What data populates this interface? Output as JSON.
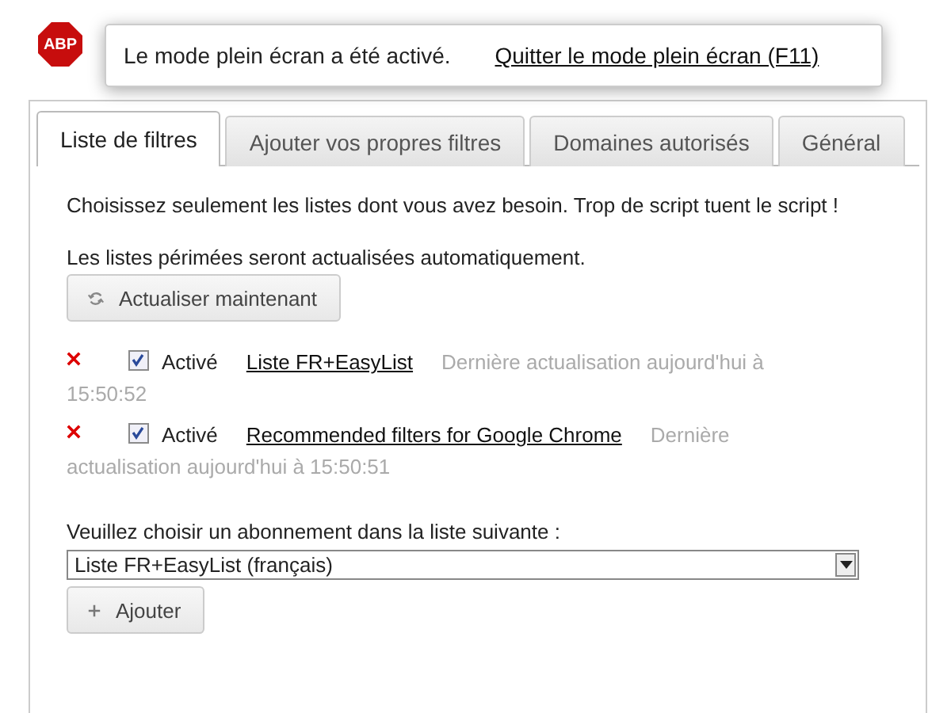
{
  "logo": "ABP",
  "notification": {
    "message": "Le mode plein écran a été activé.",
    "exit_link": "Quitter le mode plein écran (F11)"
  },
  "tabs": [
    {
      "label": "Liste de filtres",
      "selected": true
    },
    {
      "label": "Ajouter vos propres filtres",
      "selected": false
    },
    {
      "label": "Domaines autorisés",
      "selected": false
    },
    {
      "label": "Général",
      "selected": false
    }
  ],
  "intro": "Choisissez seulement les listes dont vous avez besoin. Trop de script tuent le script !",
  "auto_update_note": "Les listes périmées seront actualisées automatiquement.",
  "update_button": "Actualiser maintenant",
  "subscriptions": [
    {
      "checked": true,
      "enabled_label": "Activé",
      "name": "Liste FR+EasyList",
      "last_update": [
        "Dernière actualisation aujourd'hui à",
        "15:50:52"
      ]
    },
    {
      "checked": true,
      "enabled_label": "Activé",
      "name": "Recommended filters for Google Chrome",
      "last_update": [
        "Dernière",
        "actualisation aujourd'hui à 15:50:51"
      ]
    }
  ],
  "choose_label": "Veuillez choisir un abonnement dans la liste suivante :",
  "choose_select": {
    "value": "Liste FR+EasyList (français)"
  },
  "add_button": "Ajouter"
}
